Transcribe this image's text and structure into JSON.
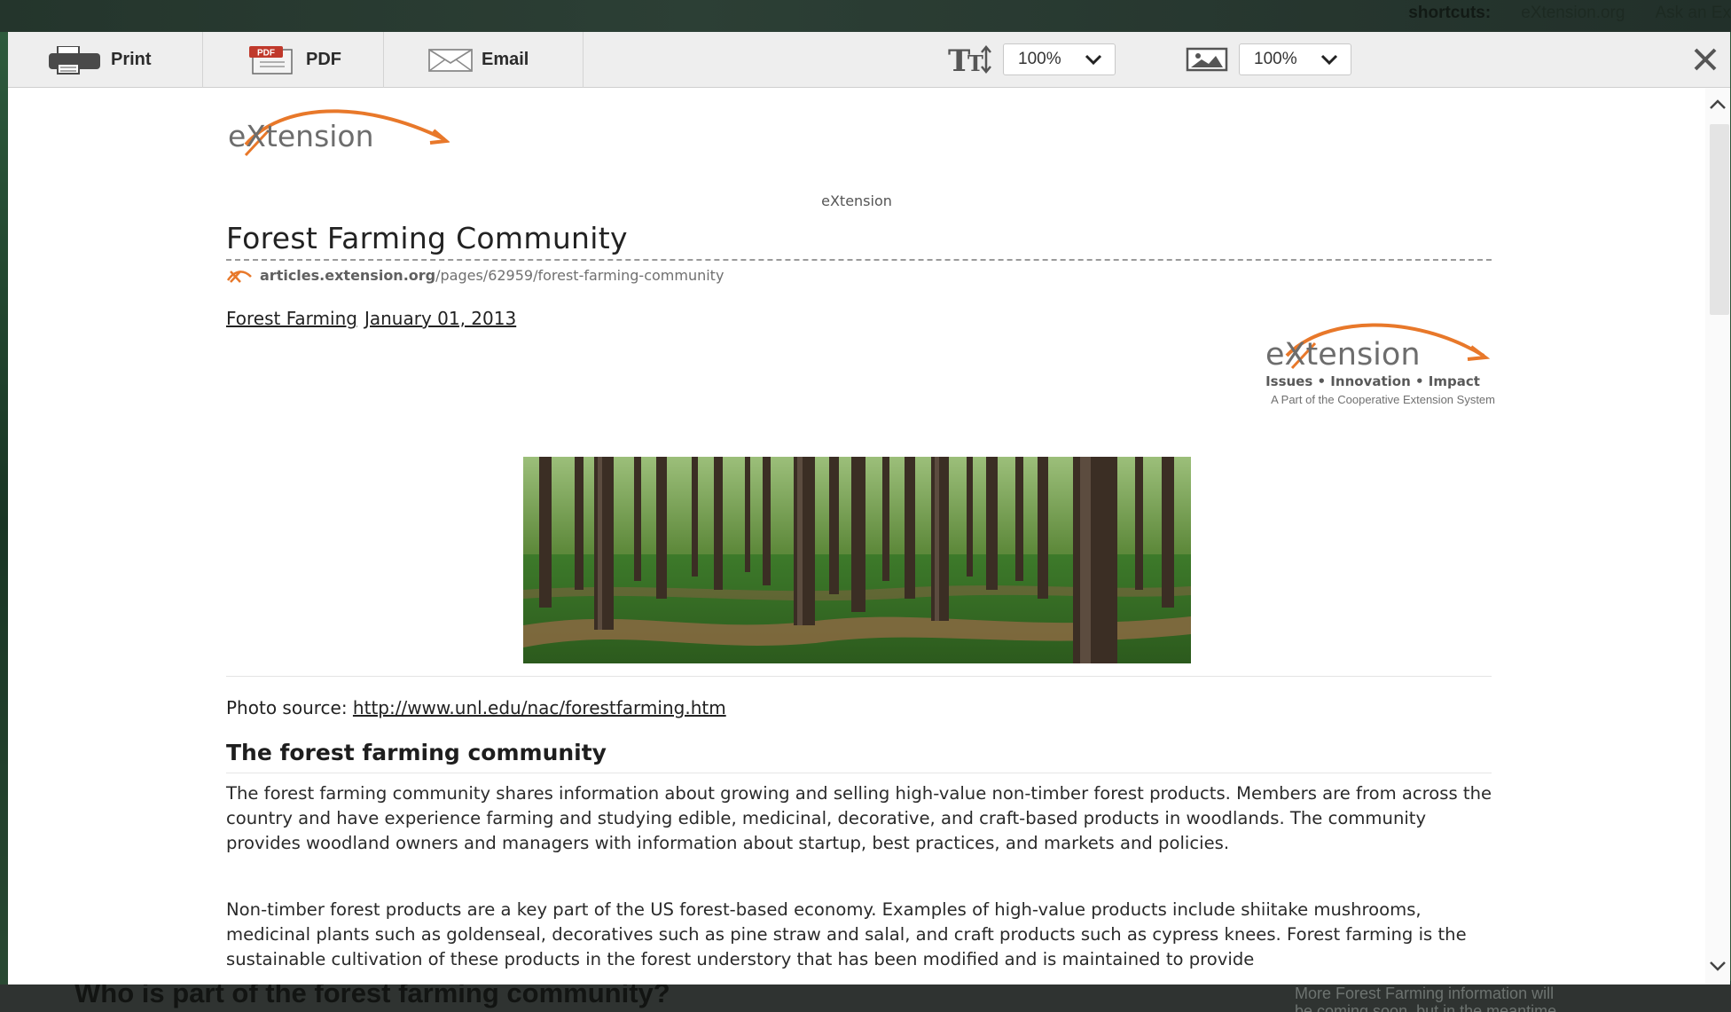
{
  "background_site": {
    "shortcuts_label": "shortcuts:",
    "shortcut_link": "eXtension.org",
    "ask_link": "Ask an Ex",
    "bottom_heading": "Who is part of the forest farming community?",
    "side_note": "More Forest Farming information will\nbe coming soon, but in the meantime"
  },
  "toolbar": {
    "print_label": "Print",
    "pdf_label": "PDF",
    "pdf_badge": "PDF",
    "email_label": "Email",
    "text_zoom": "100%",
    "image_zoom": "100%",
    "close_symbol": "✕"
  },
  "article": {
    "logo_text": "eXtension",
    "site_name": "eXtension",
    "title": "Forest Farming Community",
    "url_domain": "articles.extension.org",
    "url_path": "/pages/62959/forest-farming-community",
    "category_link": "Forest Farming",
    "date_link": "January 01, 2013",
    "logo_right_text": "eXtension",
    "logo_tagline": "Issues • Innovation • Impact",
    "logo_part_of": "A Part of the Cooperative Extension System",
    "photo_source_label": "Photo source:",
    "photo_source_url": "http://www.unl.edu/nac/forestfarming.htm",
    "section_heading": "The forest farming community",
    "paragraph_1": "The forest farming community shares information about growing and selling high-value non-timber forest products. Members are from across the country and have experience farming and studying edible, medicinal, decorative, and craft-based products in woodlands. The community provides woodland owners and managers with information about startup, best practices, and markets and policies.",
    "paragraph_2": "Non-timber forest products are a key part of the US forest-based economy. Examples of high-value products include shiitake mushrooms, medicinal plants such as goldenseal, decoratives such as pine straw and salal, and craft products such as cypress knees. Forest farming is the sustainable cultivation of these products in the forest understory that has been modified and is maintained to provide"
  },
  "icons": {
    "print": "printer-icon",
    "pdf": "pdf-file-icon",
    "email": "envelope-icon",
    "text_size": "text-size-icon",
    "image_size": "image-icon",
    "close": "close-icon",
    "chevron": "chevron-down-icon",
    "scroll_up": "chevron-up-icon",
    "scroll_down": "chevron-down-icon"
  },
  "colors": {
    "brand_orange": "#e8782a",
    "brand_grey": "#6d6d6d",
    "toolbar_bg": "#eeeeee",
    "pdf_red": "#c0392b"
  }
}
